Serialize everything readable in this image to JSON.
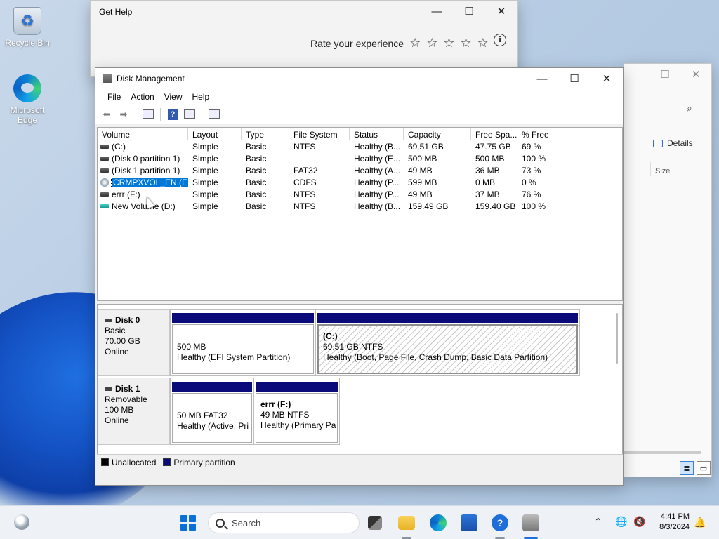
{
  "desktop": {
    "icons": [
      {
        "label": "Recycle Bin",
        "icon": "recycle-bin-icon"
      },
      {
        "label": "Microsoft Edge",
        "icon": "edge-icon"
      }
    ]
  },
  "get_help": {
    "title": "Get Help",
    "rate_text": "Rate your experience",
    "stars": [
      "☆",
      "☆",
      "☆",
      "☆",
      "☆"
    ],
    "info_glyph": "i"
  },
  "explorer": {
    "details_label": "Details",
    "size_column": "Size"
  },
  "disk_mgmt": {
    "title": "Disk Management",
    "menu": [
      "File",
      "Action",
      "View",
      "Help"
    ],
    "columns": [
      "Volume",
      "Layout",
      "Type",
      "File System",
      "Status",
      "Capacity",
      "Free Spa...",
      "% Free"
    ],
    "volumes": [
      {
        "name": "(C:)",
        "layout": "Simple",
        "type": "Basic",
        "fs": "NTFS",
        "status": "Healthy (B...",
        "capacity": "69.51 GB",
        "free": "47.75 GB",
        "pct": "69 %",
        "icon": "drive"
      },
      {
        "name": "(Disk 0 partition 1)",
        "layout": "Simple",
        "type": "Basic",
        "fs": "",
        "status": "Healthy (E...",
        "capacity": "500 MB",
        "free": "500 MB",
        "pct": "100 %",
        "icon": "drive"
      },
      {
        "name": "(Disk 1 partition 1)",
        "layout": "Simple",
        "type": "Basic",
        "fs": "FAT32",
        "status": "Healthy (A...",
        "capacity": "49 MB",
        "free": "36 MB",
        "pct": "73 %",
        "icon": "drive"
      },
      {
        "name": "CRMPXVOL_EN (E:)",
        "layout": "Simple",
        "type": "Basic",
        "fs": "CDFS",
        "status": "Healthy (P...",
        "capacity": "599 MB",
        "free": "0 MB",
        "pct": "0 %",
        "icon": "cd",
        "selected": true
      },
      {
        "name": "errr (F:)",
        "layout": "Simple",
        "type": "Basic",
        "fs": "NTFS",
        "status": "Healthy (P...",
        "capacity": "49 MB",
        "free": "37 MB",
        "pct": "76 %",
        "icon": "drive"
      },
      {
        "name": "New Volume (D:)",
        "layout": "Simple",
        "type": "Basic",
        "fs": "NTFS",
        "status": "Healthy (B...",
        "capacity": "159.49 GB",
        "free": "159.40 GB",
        "pct": "100 %",
        "icon": "teal"
      }
    ],
    "disks": [
      {
        "name": "Disk 0",
        "kind": "Basic",
        "size": "70.00 GB",
        "state": "Online",
        "partitions": [
          {
            "label": "",
            "line1": "500 MB",
            "line2": "Healthy (EFI System Partition)"
          },
          {
            "label": "(C:)",
            "line1": "69.51 GB NTFS",
            "line2": "Healthy (Boot, Page File, Crash Dump, Basic Data Partition)"
          }
        ]
      },
      {
        "name": "Disk 1",
        "kind": "Removable",
        "size": "100 MB",
        "state": "Online",
        "partitions": [
          {
            "label": "",
            "line1": "50 MB FAT32",
            "line2": "Healthy (Active, Pri"
          },
          {
            "label": "errr  (F:)",
            "line1": "49 MB NTFS",
            "line2": "Healthy (Primary Pa"
          }
        ]
      }
    ],
    "legend": [
      {
        "label": "Unallocated",
        "color": "#000000"
      },
      {
        "label": "Primary partition",
        "color": "#0a0a7a"
      }
    ]
  },
  "taskbar": {
    "search_placeholder": "Search",
    "time": "4:41 PM",
    "date": "8/3/2024",
    "help_glyph": "?"
  }
}
